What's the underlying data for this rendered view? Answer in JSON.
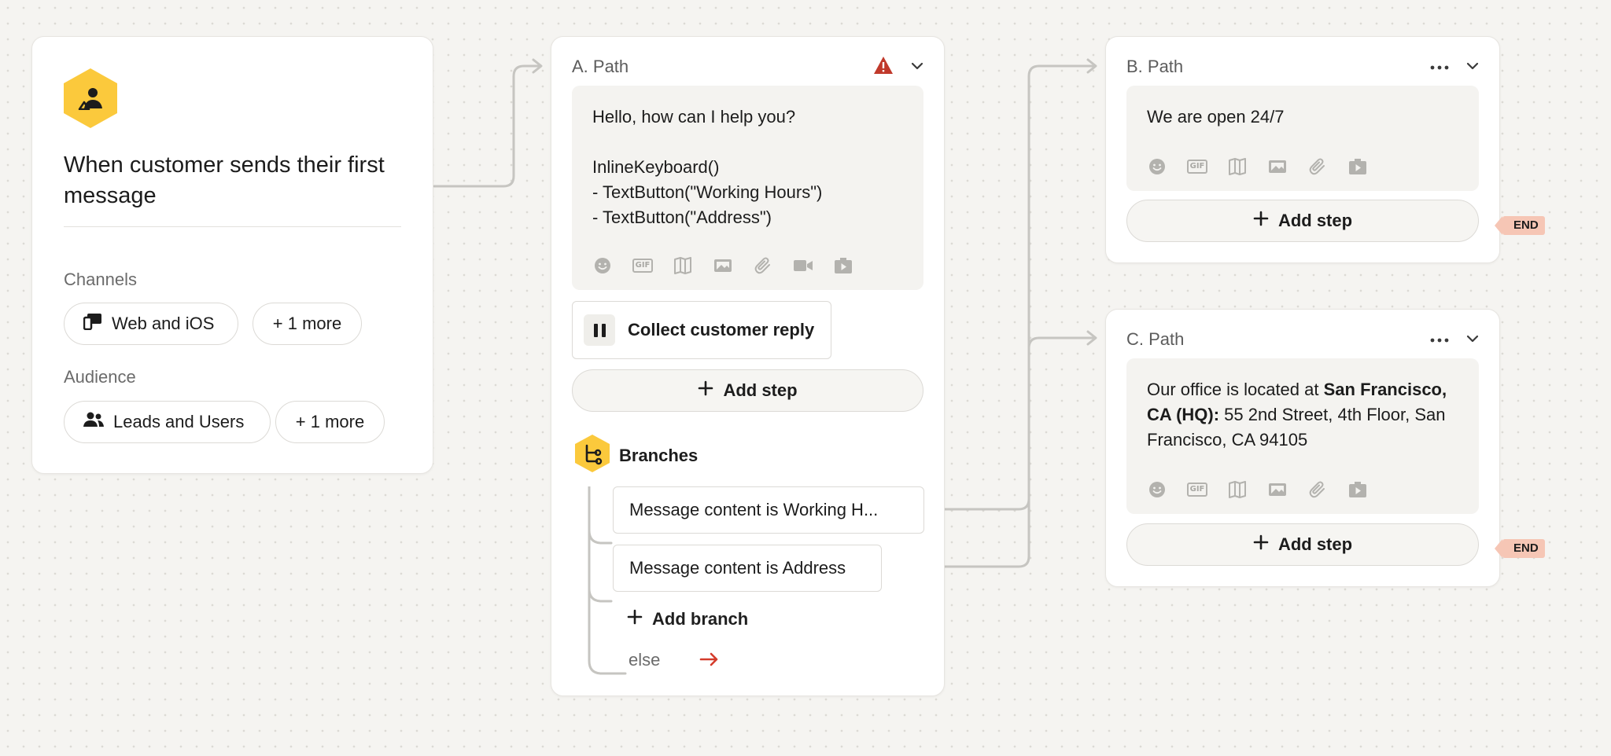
{
  "trigger": {
    "title": "When customer sends their first message",
    "channels_label": "Channels",
    "channels_value": "Web and iOS",
    "channels_more": "+ 1 more",
    "audience_label": "Audience",
    "audience_value": "Leads and Users",
    "audience_more": "+ 1 more",
    "accent_color": "#fbc93c"
  },
  "path_a": {
    "title": "A. Path",
    "message_lines": [
      "Hello, how can I help you?",
      "",
      "InlineKeyboard()",
      "- TextButton(\"Working Hours\")",
      "- TextButton(\"Address\")"
    ],
    "collect_label": "Collect customer reply",
    "add_step": "Add step",
    "branches_title": "Branches",
    "branches": [
      "Message content is Working H...",
      "Message content is Address"
    ],
    "add_branch": "Add branch",
    "else_label": "else"
  },
  "path_b": {
    "title": "B. Path",
    "message": "We are open 24/7",
    "add_step": "Add step",
    "end_label": "END"
  },
  "path_c": {
    "title": "C. Path",
    "message_prefix": "Our office is located at ",
    "message_bold": "San Francisco, CA (HQ):",
    "message_suffix": " 55 2nd Street, 4th Floor, San Francisco, CA 94105",
    "add_step": "Add step",
    "end_label": "END"
  },
  "toolbar_icons": [
    "emoji-icon",
    "gif-icon",
    "article-icon",
    "image-icon",
    "attachment-icon",
    "video-icon",
    "app-icon"
  ],
  "colors": {
    "warning": "#c0392b",
    "else_arrow": "#d43c2c",
    "end_tag": "#f6c6b5",
    "connector": "#c6c5c1"
  }
}
